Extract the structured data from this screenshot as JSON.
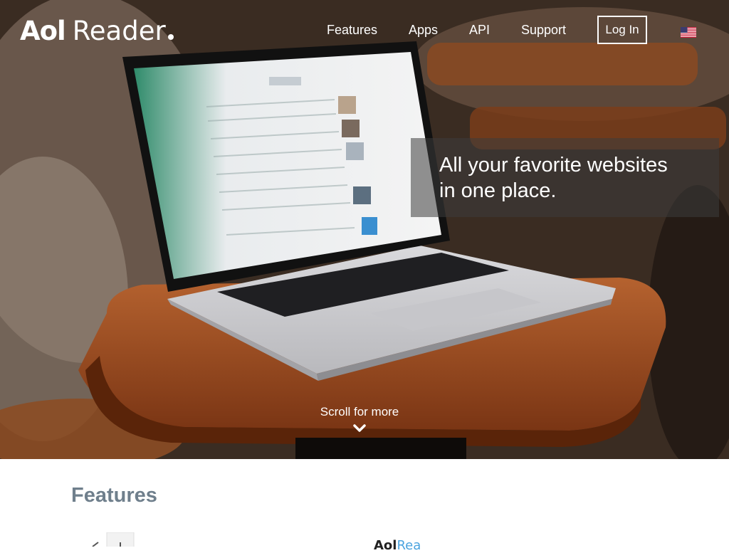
{
  "brand": {
    "aol": "Aol",
    "reader": "Reader"
  },
  "nav": {
    "features": "Features",
    "apps": "Apps",
    "api": "API",
    "support": "Support",
    "login": "Log In"
  },
  "hero": {
    "tagline_line1": "All your favorite websites",
    "tagline_line2": "in one place.",
    "scroll_label": "Scroll for more"
  },
  "sections": {
    "features_title": "Features",
    "peek_logo_aol": "Aol",
    "peek_logo_reader": "Rea"
  },
  "icons": {
    "language": "us-flag-icon",
    "scroll": "chevron-down-icon"
  },
  "colors": {
    "features_heading": "#6f7f8c",
    "accent": "#4aa3df"
  }
}
